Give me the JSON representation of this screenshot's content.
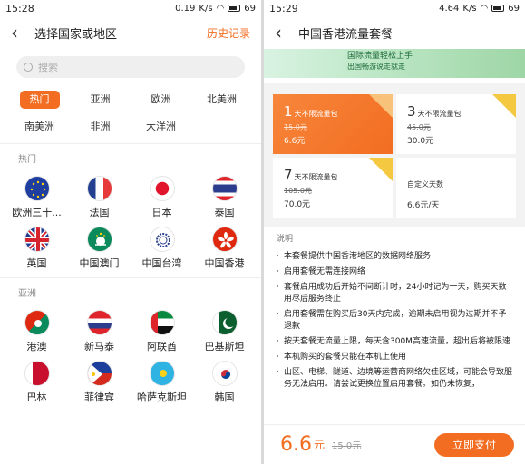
{
  "left": {
    "status": {
      "time": "15:28",
      "speed": "0.19",
      "speed_unit": "K/s",
      "battery": "69"
    },
    "header": {
      "title": "选择国家或地区",
      "history": "历史记录"
    },
    "search": {
      "placeholder": "搜索"
    },
    "regions": [
      "热门",
      "亚洲",
      "欧洲",
      "北美洲",
      "南美洲",
      "非洲",
      "大洋洲"
    ],
    "hot_label": "热门",
    "hot": [
      "欧洲三十...",
      "法国",
      "日本",
      "泰国",
      "英国",
      "中国澳门",
      "中国台湾",
      "中国香港"
    ],
    "asia_label": "亚洲",
    "asia": [
      "港澳",
      "新马泰",
      "阿联酋",
      "巴基斯坦",
      "巴林",
      "菲律宾",
      "哈萨克斯坦",
      "韩国"
    ],
    "flag_icons": [
      "eu-flag-icon",
      "france-flag-icon",
      "japan-flag-icon",
      "thailand-flag-icon",
      "uk-flag-icon",
      "macau-flag-icon",
      "taiwan-flag-icon",
      "hongkong-flag-icon",
      "hk-macau-flag-icon",
      "sg-my-th-flag-icon",
      "uae-flag-icon",
      "pakistan-flag-icon",
      "bahrain-flag-icon",
      "philippines-flag-icon",
      "kazakhstan-flag-icon",
      "korea-flag-icon"
    ]
  },
  "right": {
    "status": {
      "time": "15:29",
      "speed": "4.64",
      "speed_unit": "K/s",
      "battery": "69"
    },
    "header": {
      "title": "中国香港流量套餐"
    },
    "banner": {
      "line1": "国际流量轻松上手",
      "line2": "出国畅游说走就走"
    },
    "plans": [
      {
        "days": "1",
        "label": "天不限流量包",
        "old": "15.0元",
        "price": "6.6元",
        "selected": true
      },
      {
        "days": "3",
        "label": "天不限流量包",
        "old": "45.0元",
        "price": "30.0元",
        "selected": false
      },
      {
        "days": "7",
        "label": "天不限流量包",
        "old": "105.0元",
        "price": "70.0元",
        "selected": false
      }
    ],
    "custom": {
      "label": "自定义天数",
      "price": "6.6元/天"
    },
    "notes_title": "说明",
    "notes": [
      "本套餐提供中国香港地区的数据网络服务",
      "启用套餐无需连接网络",
      "套餐启用成功后开始不间断计时，24小时记为一天，购买天数用尽后服务终止",
      "启用套餐需在购买后30天内完成，逾期未启用视为过期并不予退款",
      "按天套餐无流量上限，每天含300M高速流量，超出后将被限速",
      "本机购买的套餐只能在本机上使用",
      "山区、电梯、隧道、边境等运营商网络欠佳区域，可能会导致服务无法启用。请尝试更换位置启用套餐。如仍未恢复，"
    ],
    "footer": {
      "price": "6.6",
      "unit": "元",
      "old": "15.0元",
      "pay": "立即支付"
    },
    "accent": "#f26d21"
  }
}
